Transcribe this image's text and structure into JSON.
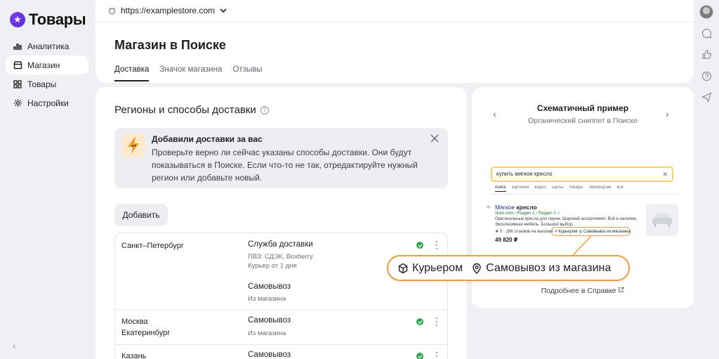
{
  "brand": {
    "name": "Товары",
    "logo_glyph": "★"
  },
  "sidebar": {
    "items": [
      {
        "label": "Аналитика",
        "icon": "analytics-icon"
      },
      {
        "label": "Магазин",
        "icon": "store-icon",
        "active": true
      },
      {
        "label": "Товары",
        "icon": "grid-icon"
      },
      {
        "label": "Настройки",
        "icon": "gear-icon"
      }
    ],
    "collapse_glyph": "‹"
  },
  "topbar": {
    "url": "https://examplestore.com"
  },
  "header": {
    "title": "Магазин в Поиске",
    "tabs": [
      "Доставка",
      "Значок магазина",
      "Отзывы"
    ]
  },
  "main": {
    "section_title": "Регионы и способы доставки",
    "help_glyph": "?",
    "notice": {
      "title": "Добавили доставки за вас",
      "text": "Проверьте верно ли сейчас указаны способы доставки. Они будут показываться в Поиске. Если что-то не так, отредактируйте нужный регион или добавьте новый."
    },
    "add_button": "Добавить",
    "rows": [
      {
        "cities": [
          "Санкт–Петербург"
        ],
        "methods": [
          {
            "title": "Служба доставки",
            "details": [
              "ПВЗ: СДЭК, Boxberry",
              "Курьер от 1 дня"
            ]
          },
          {
            "title": "Самовывоз",
            "details": [
              "Из магазина"
            ]
          }
        ]
      },
      {
        "cities": [
          "Москва",
          "Екатеринбург"
        ],
        "methods": [
          {
            "title": "Самовывоз",
            "details": [
              "Из магазина"
            ]
          }
        ]
      },
      {
        "cities": [
          "Казань"
        ],
        "methods": [
          {
            "title": "Самовывоз",
            "details": []
          }
        ]
      }
    ]
  },
  "preview": {
    "title": "Схематичный пример",
    "subtitle": "Органический сниппет в Поиске",
    "prev_glyph": "‹",
    "next_glyph": "›",
    "search_query": "купить мягкое кресло",
    "serp_tabs": [
      "поиск",
      "картинки",
      "видео",
      "карты",
      "товары",
      "переводчик",
      "все"
    ],
    "result": {
      "title_plain": "Мягкое ",
      "title_bold": "кресло",
      "host": "store.com › Раздел 1 › Раздел 2 ",
      "description": "Оригинальные кресла для лаунж. Широкий ассортимент. Всё в наличии. Эксклюзивная мебель. Большой выбор.",
      "rating": "★ 5 · 28К отзывов на магазин",
      "chip": "⌾ Курьером  ◎ Самовывоз из магазина",
      "price": "49 820 ₽"
    },
    "help_link": "Подробнее в Справке"
  },
  "callout": {
    "courier": "Курьером",
    "pickup": "Самовывоз из магазина"
  },
  "colors": {
    "accent": "#ef9c3e",
    "ok": "#2fa84f",
    "brand": "#7b3ff2"
  }
}
